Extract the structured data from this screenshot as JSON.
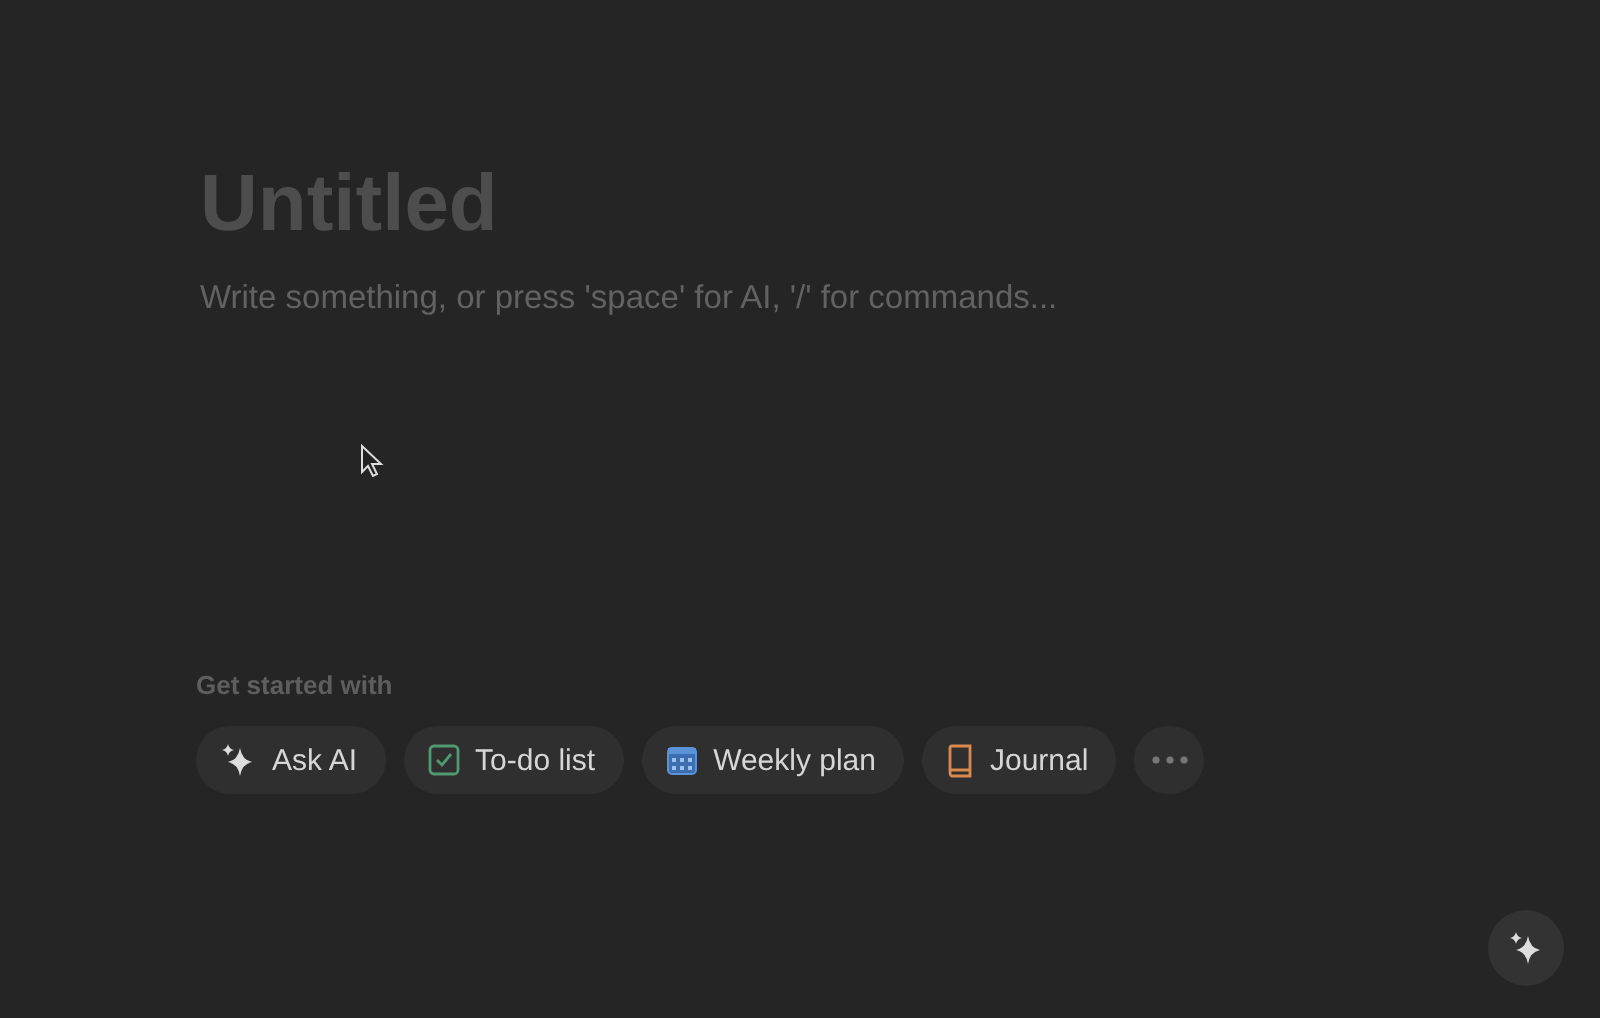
{
  "page": {
    "title_placeholder": "Untitled",
    "body_placeholder": "Write something, or press 'space' for AI, '/' for commands..."
  },
  "get_started": {
    "label": "Get started with",
    "chips": [
      {
        "kind": "ai",
        "label": "Ask AI"
      },
      {
        "kind": "todo",
        "label": "To-do list"
      },
      {
        "kind": "calendar",
        "label": "Weekly plan"
      },
      {
        "kind": "book",
        "label": "Journal"
      },
      {
        "kind": "more"
      }
    ]
  }
}
